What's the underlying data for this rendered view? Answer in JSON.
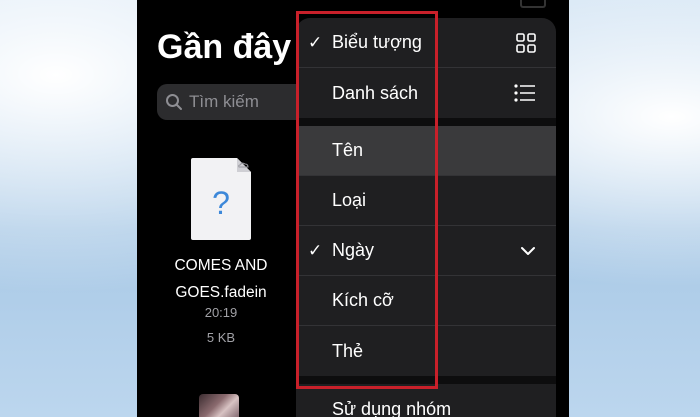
{
  "header": {
    "title": "Gần đây"
  },
  "search": {
    "placeholder": "Tìm kiếm"
  },
  "file": {
    "name_line1": "COMES AND",
    "name_line2": "GOES.fadein",
    "time": "20:19",
    "size": "5 KB"
  },
  "menu": {
    "view_options": [
      {
        "label": "Biểu tượng",
        "checked": true,
        "icon": "grid-icon"
      },
      {
        "label": "Danh sách",
        "checked": false,
        "icon": "list-icon"
      }
    ],
    "sort_options": [
      {
        "label": "Tên",
        "checked": false
      },
      {
        "label": "Loại",
        "checked": false
      },
      {
        "label": "Ngày",
        "checked": true,
        "icon": "chevron-down-icon"
      },
      {
        "label": "Kích cỡ",
        "checked": false
      },
      {
        "label": "Thẻ",
        "checked": false
      }
    ],
    "group_label": "Sử dụng nhóm",
    "check_mark": "✓"
  },
  "colors": {
    "highlight_frame": "#c8202a",
    "menu_background": "#1f1f21",
    "file_icon_glyph": "#3d88d9"
  }
}
